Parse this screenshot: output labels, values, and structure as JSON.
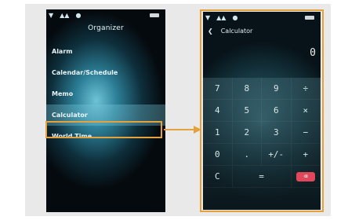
{
  "organizer": {
    "title": "Organizer",
    "items": [
      "Alarm",
      "Calendar/Schedule",
      "Memo",
      "Calculator",
      "World Time"
    ],
    "selected_index": 3
  },
  "calculator": {
    "title": "Calculator",
    "display_value": "0",
    "keys": {
      "r1": [
        "7",
        "8",
        "9",
        "÷"
      ],
      "r2": [
        "4",
        "5",
        "6",
        "×"
      ],
      "r3": [
        "1",
        "2",
        "3",
        "−"
      ],
      "r4": [
        "0",
        ".",
        "+/-",
        "+"
      ],
      "r5": [
        "C",
        "=",
        "⌫"
      ]
    }
  },
  "colors": {
    "highlight": "#e3a23b",
    "delete_key": "#e1475a"
  }
}
